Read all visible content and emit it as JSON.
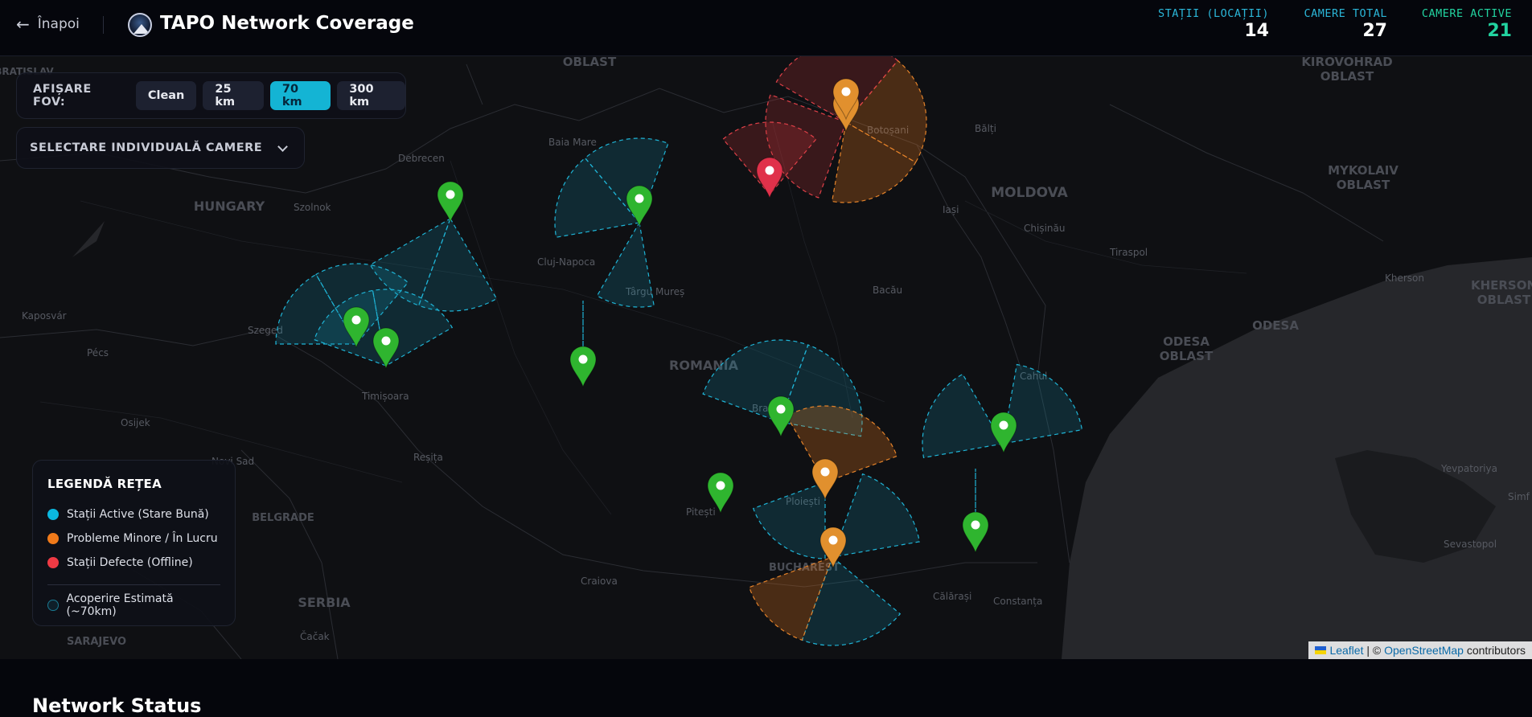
{
  "header": {
    "back_label": "Înapoi",
    "title": "TAPO Network Coverage",
    "stats": [
      {
        "label": "STAȚII (LOCAȚII)",
        "value": "14",
        "color": "#2bb6d8"
      },
      {
        "label": "CAMERE TOTAL",
        "value": "27",
        "color": "#2bb6d8"
      },
      {
        "label": "CAMERE ACTIVE",
        "value": "21",
        "color": "#22d3a0"
      }
    ]
  },
  "fov": {
    "label": "AFIȘARE FOV:",
    "options": [
      "Clean",
      "25 km",
      "70 km",
      "300 km"
    ],
    "selected": "70 km"
  },
  "camera_select": {
    "label": "SELECTARE INDIVIDUALĂ CAMERE"
  },
  "legend": {
    "title": "LEGENDĂ REȚEA",
    "items": [
      {
        "label": "Stații Active (Stare Bună)",
        "color": "#0bb8e0"
      },
      {
        "label": "Probleme Minore / În Lucru",
        "color": "#f07a1a"
      },
      {
        "label": "Stații Defecte (Offline)",
        "color": "#ef3a44"
      }
    ],
    "coverage_label": "Acoperire Estimată (~70km)"
  },
  "map_labels": {
    "regions": [
      "OBLAST",
      "HUNGARY",
      "MOLDOVA",
      "ROMANIA",
      "SERBIA",
      "KIROVOHRAD",
      "OBLAST",
      "MYKOLAIV",
      "OBLAST",
      "ODESA",
      "OBLAST",
      "KHERSON",
      "OBLAST",
      "ODESA",
      "BUCHAREST",
      "BELGRADE",
      "SARAJEVO",
      "BRATISLAV"
    ],
    "cities": [
      "Debrecen",
      "Szolnok",
      "Baia Mare",
      "Cluj-Napoca",
      "Târgu Mureș",
      "Iași",
      "Chișinău",
      "Tiraspol",
      "Bacău",
      "Kaposvár",
      "Szeged",
      "Pécs",
      "Timișoara",
      "Osijek",
      "Novi Sad",
      "Reșița",
      "Brașov",
      "Ploiești",
      "Pitești",
      "Craiova",
      "Călărași",
      "Constanța",
      "Cahul",
      "Kherson",
      "Bălți",
      "Botoșani",
      "Čačak",
      "Yevpatoriya",
      "Sevastopol",
      "Simf"
    ]
  },
  "stations": [
    {
      "status": "active"
    },
    {
      "status": "active"
    },
    {
      "status": "active"
    },
    {
      "status": "active"
    },
    {
      "status": "active"
    },
    {
      "status": "active"
    },
    {
      "status": "active"
    },
    {
      "status": "minor"
    },
    {
      "status": "minor"
    },
    {
      "status": "minor"
    },
    {
      "status": "active"
    },
    {
      "status": "active"
    },
    {
      "status": "minor"
    },
    {
      "status": "offline"
    }
  ],
  "attribution": {
    "leaflet": "Leaflet",
    "osm": "OpenStreetMap",
    "suffix": "contributors"
  },
  "section_title": "Network Status"
}
